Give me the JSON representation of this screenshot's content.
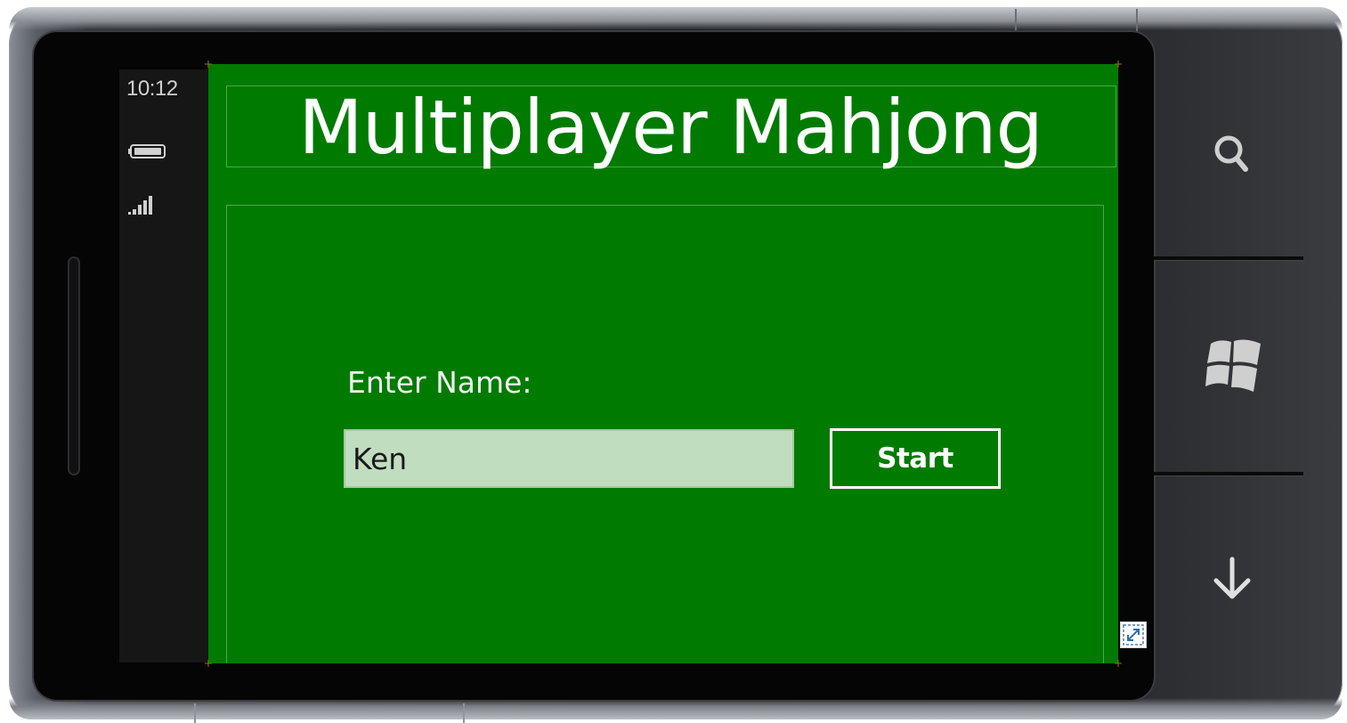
{
  "status_bar": {
    "time": "10:12",
    "battery_icon": "battery-icon",
    "signal_icon": "signal-strength-icon"
  },
  "app": {
    "title": "Multiplayer Mahjong",
    "name_label": "Enter Name:",
    "name_input_value": "Ken",
    "start_label": "Start",
    "background_color": "#007b00",
    "input_background": "#c1ddbf"
  },
  "hardware_buttons": [
    {
      "name": "search-button",
      "icon": "search-icon"
    },
    {
      "name": "windows-button",
      "icon": "windows-logo-icon"
    },
    {
      "name": "back-button",
      "icon": "arrow-down-icon"
    }
  ],
  "emulator": {
    "resize_icon": "fit-to-screen-icon"
  }
}
